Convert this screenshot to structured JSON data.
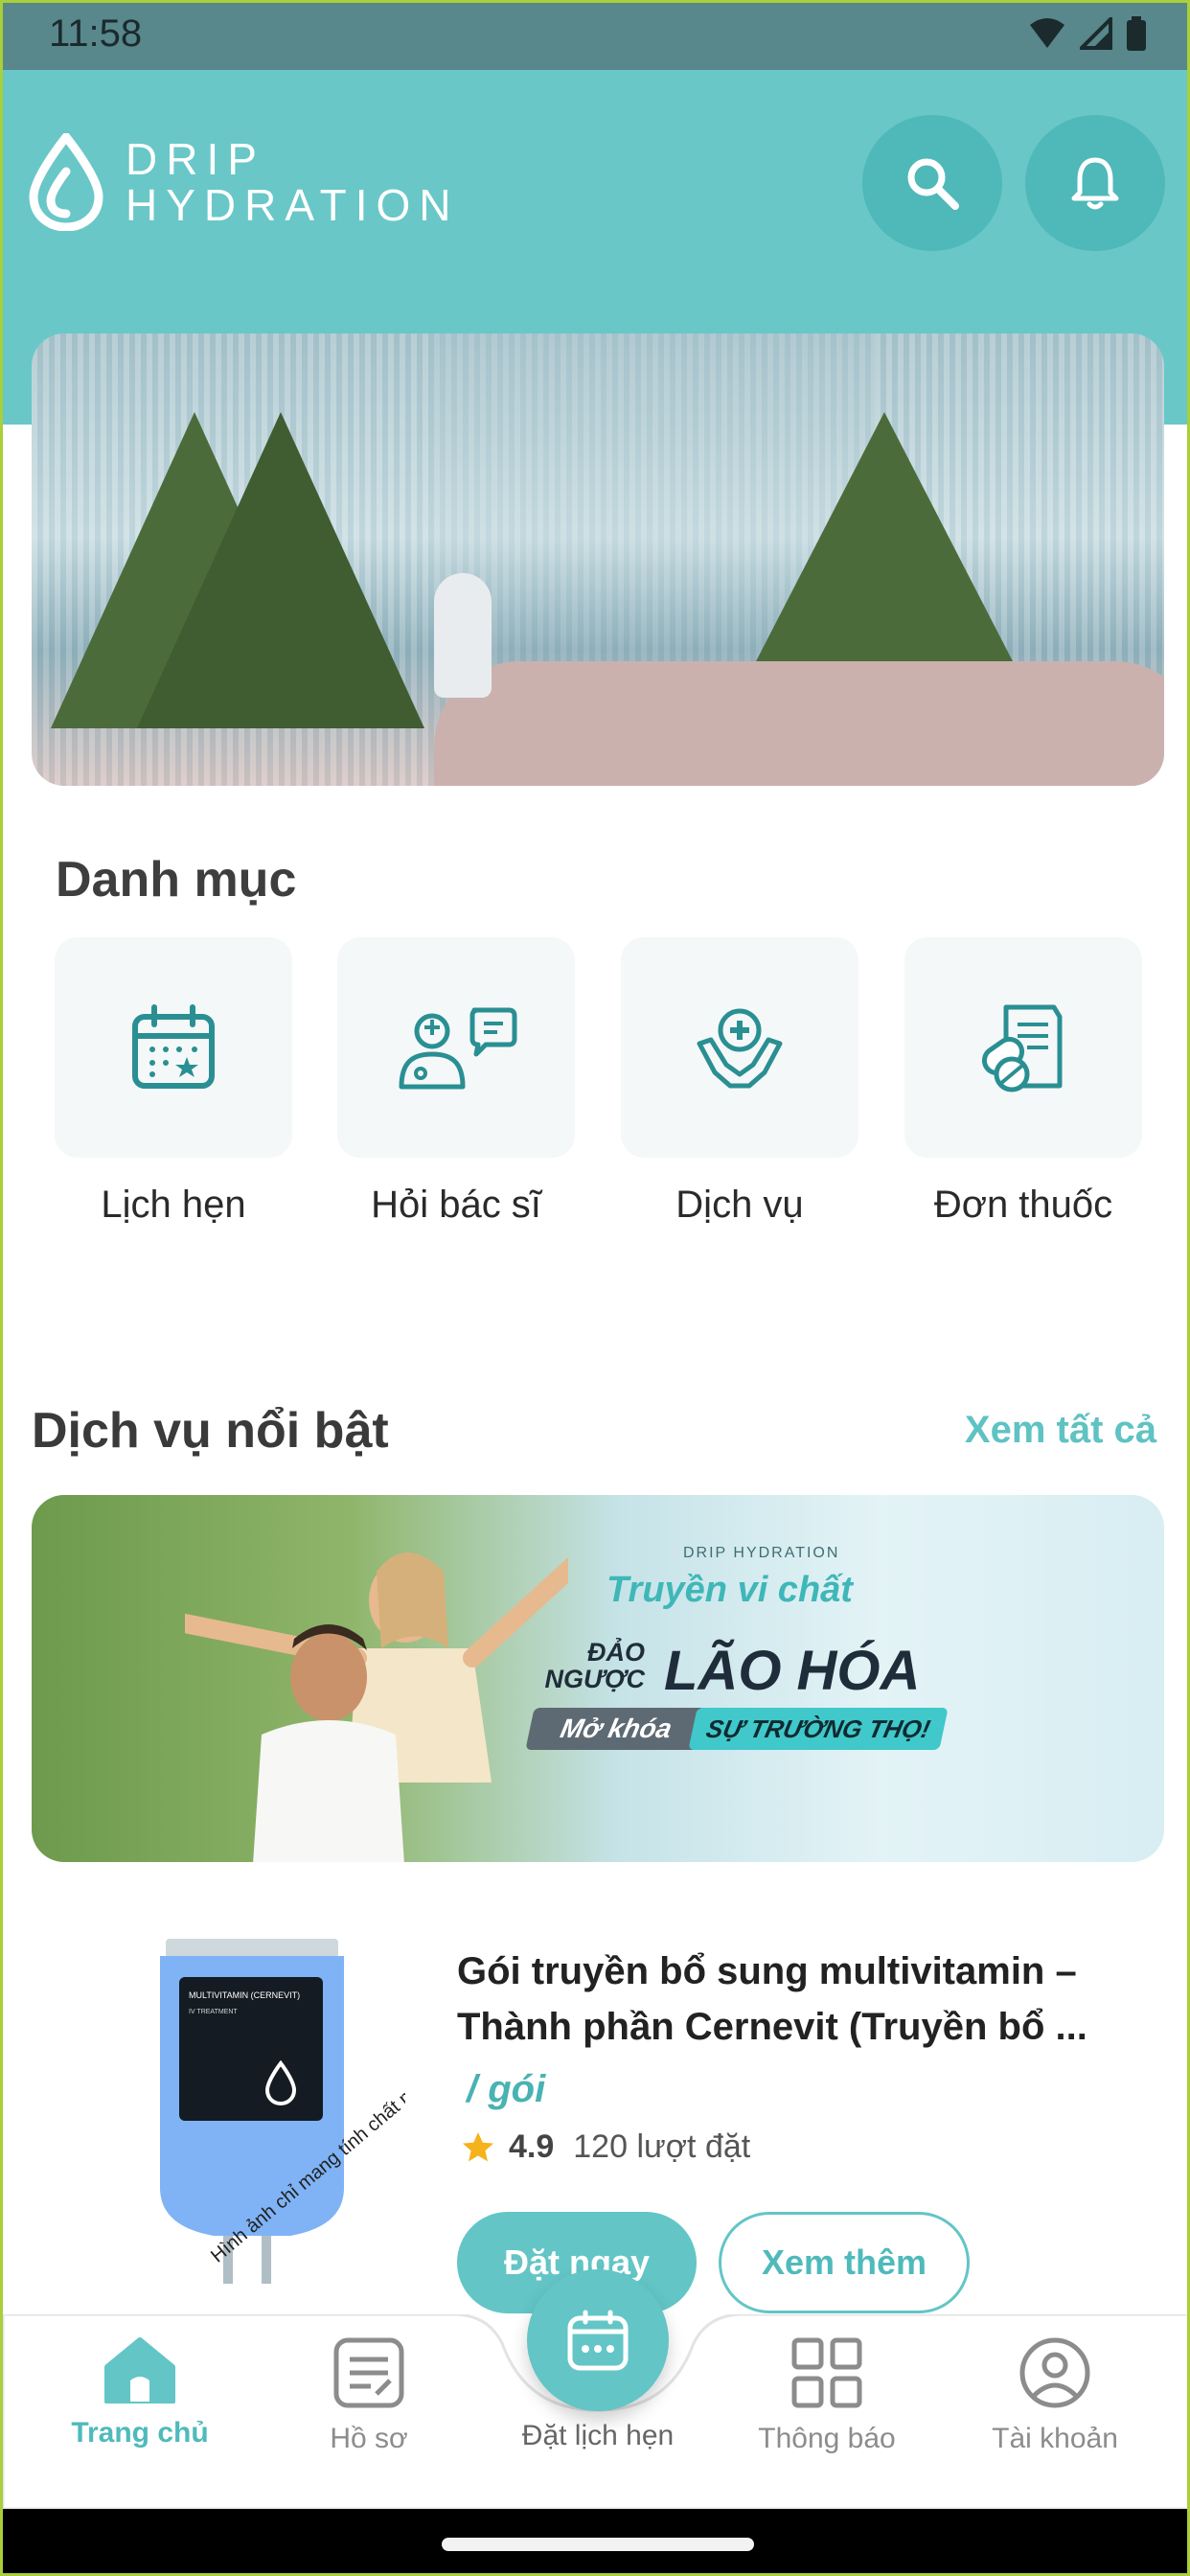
{
  "status_bar": {
    "time": "11:58"
  },
  "header": {
    "brand_line1": "DRIP",
    "brand_line2": "HYDRATION"
  },
  "categories": {
    "title": "Danh mục",
    "items": [
      {
        "label": "Lịch hẹn",
        "icon": "calendar-star-icon"
      },
      {
        "label": "Hỏi bác sĩ",
        "icon": "doctor-chat-icon"
      },
      {
        "label": "Dịch vụ",
        "icon": "care-hands-icon"
      },
      {
        "label": "Đơn thuốc",
        "icon": "prescription-icon"
      }
    ]
  },
  "featured": {
    "title": "Dịch vụ nổi bật",
    "see_all": "Xem tất cả",
    "promo": {
      "brand": "DRIP HYDRATION",
      "line1": "Truyền vi chất",
      "line2a": "ĐẢO NGƯỢC",
      "line2b": "LÃO HÓA",
      "pill1": "Mở khóa",
      "pill2": "SỰ TRƯỜNG THỌ!"
    }
  },
  "product": {
    "name": "Gói truyền bổ sung multivitamin – Thành phần Cernevit (Truyền bổ ...",
    "price": "/ gói",
    "rating": "4.9",
    "bookings": "120 lượt đặt",
    "book_label": "Đặt ngay",
    "more_label": "Xem thêm",
    "image_stamp": "Hình ảnh chỉ mang tính chất minh họa",
    "bag_label": "MULTIVITAMIN (CERNEVIT)",
    "bag_sub": "IV TREATMENT"
  },
  "bottom_nav": {
    "items": [
      {
        "label": "Trang chủ",
        "active": true
      },
      {
        "label": "Hồ sơ",
        "active": false
      },
      {
        "label": "Thông báo",
        "active": false
      },
      {
        "label": "Tài khoản",
        "active": false
      }
    ],
    "center_label": "Đặt lịch hẹn"
  },
  "colors": {
    "primary": "#63c5c6",
    "header": "#69c7c8",
    "status_bar": "#58878c"
  }
}
